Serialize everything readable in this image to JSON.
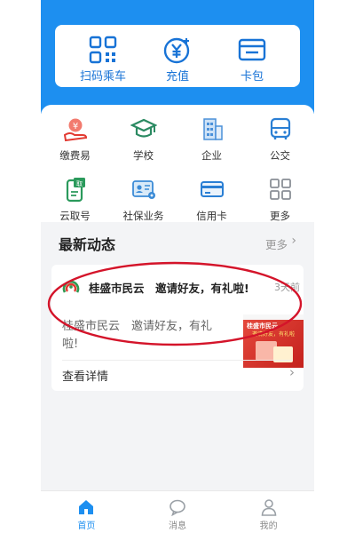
{
  "colors": {
    "primary": "#1d8ff0",
    "accent_red": "#e23a32",
    "annotation": "#d4142a"
  },
  "quick_actions": [
    {
      "label": "扫码乘车",
      "icon": "qr-scan-icon"
    },
    {
      "label": "充值",
      "icon": "yuan-coin-icon"
    },
    {
      "label": "卡包",
      "icon": "wallet-icon"
    }
  ],
  "services": [
    {
      "label": "缴费易",
      "icon": "payment-hand-icon"
    },
    {
      "label": "学校",
      "icon": "graduation-cap-icon"
    },
    {
      "label": "企业",
      "icon": "building-icon"
    },
    {
      "label": "公交",
      "icon": "bus-icon"
    },
    {
      "label": "云取号",
      "icon": "queue-ticket-icon"
    },
    {
      "label": "社保业务",
      "icon": "id-card-icon"
    },
    {
      "label": "信用卡",
      "icon": "credit-card-icon"
    },
    {
      "label": "更多",
      "icon": "grid-more-icon"
    }
  ],
  "news": {
    "section_title": "最新动态",
    "more_label": "更多",
    "more_icon": "chevron-right-icon",
    "item": {
      "source": "桂盛市民云",
      "headline": "邀请好友，有礼啦!",
      "time": "3天前",
      "body": "桂盛市民云　邀请好友，有礼啦!",
      "detail_label": "查看详情",
      "thumb_line1": "桂盛市民云",
      "thumb_line2": "邀请好友，有礼啦"
    }
  },
  "bottom_nav": [
    {
      "label": "首页",
      "icon": "home-icon",
      "active": true
    },
    {
      "label": "消息",
      "icon": "chat-bubble-icon",
      "active": false
    },
    {
      "label": "我的",
      "icon": "user-icon",
      "active": false
    }
  ]
}
